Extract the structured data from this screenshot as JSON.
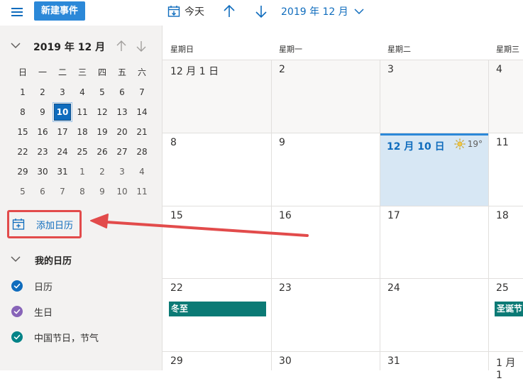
{
  "toolbar": {
    "new_event_label": "新建事件",
    "today_label": "今天",
    "current_month_label": "2019 年 12 月"
  },
  "mini_calendar": {
    "title": "2019 年 12 月",
    "weekdays": [
      "日",
      "一",
      "二",
      "三",
      "四",
      "五",
      "六"
    ],
    "weeks": [
      [
        "1",
        "2",
        "3",
        "4",
        "5",
        "6",
        "7"
      ],
      [
        "8",
        "9",
        "10",
        "11",
        "12",
        "13",
        "14"
      ],
      [
        "15",
        "16",
        "17",
        "18",
        "19",
        "20",
        "21"
      ],
      [
        "22",
        "23",
        "24",
        "25",
        "26",
        "27",
        "28"
      ],
      [
        "29",
        "30",
        "31",
        "1",
        "2",
        "3",
        "4"
      ],
      [
        "5",
        "6",
        "7",
        "8",
        "9",
        "10",
        "11"
      ]
    ],
    "selected_day": "10"
  },
  "sidebar": {
    "add_calendar_label": "添加日历",
    "my_calendars_title": "我的日历",
    "calendars": [
      {
        "label": "日历",
        "color": "#0f6cbd"
      },
      {
        "label": "生日",
        "color": "#8764b8"
      },
      {
        "label": "中国节日，节气",
        "color": "#038387"
      }
    ]
  },
  "month_view": {
    "weekday_headers": [
      "星期日",
      "星期一",
      "星期二",
      "星期三"
    ],
    "rows": [
      [
        "12 月 1 日",
        "2",
        "3",
        "4"
      ],
      [
        "8",
        "9",
        "12 月 10 日",
        "11"
      ],
      [
        "15",
        "16",
        "17",
        "18"
      ],
      [
        "22",
        "23",
        "24",
        "25"
      ],
      [
        "29",
        "30",
        "31",
        "1 月 1"
      ]
    ],
    "weather": {
      "temp": "19°",
      "icon": "sun-icon"
    },
    "events": [
      {
        "label": "冬至",
        "color": "#0b7a75"
      },
      {
        "label": "圣诞节",
        "color": "#0b7a75"
      }
    ]
  },
  "colors": {
    "accent": "#0f6cbd",
    "today_bg": "#d7e7f4",
    "annotation_red": "#e24b4b"
  }
}
